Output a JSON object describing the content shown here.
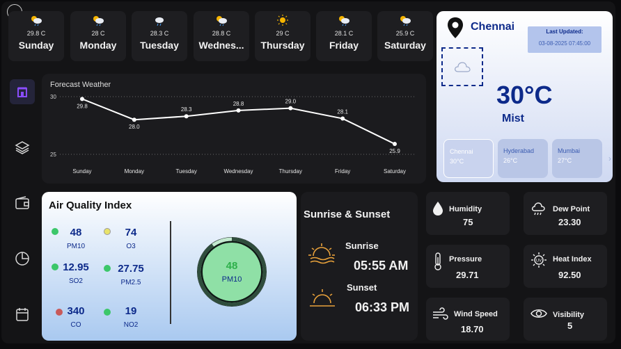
{
  "nav": {
    "back": "back"
  },
  "days": [
    {
      "temp": "29.8 C",
      "name": "Sunday",
      "icon": "partly-sunny-rain-icon"
    },
    {
      "temp": "28 C",
      "name": "Monday",
      "icon": "partly-sunny-rain-icon"
    },
    {
      "temp": "28.3 C",
      "name": "Tuesday",
      "icon": "cloud-rain-icon"
    },
    {
      "temp": "28.8 C",
      "name": "Wednes...",
      "icon": "partly-sunny-rain-icon"
    },
    {
      "temp": "29 C",
      "name": "Thursday",
      "icon": "sun-icon"
    },
    {
      "temp": "28.1 C",
      "name": "Friday",
      "icon": "partly-sunny-rain-icon"
    },
    {
      "temp": "25.9 C",
      "name": "Saturday",
      "icon": "partly-sunny-rain-icon"
    }
  ],
  "sidebar": [
    "home-icon",
    "layers-icon",
    "wallet-icon",
    "pie-chart-icon",
    "calendar-icon"
  ],
  "forecast": {
    "title": "Forecast Weather"
  },
  "chart_data": {
    "type": "line",
    "title": "Forecast Weather",
    "categories": [
      "Sunday",
      "Monday",
      "Tuesday",
      "Wednesday",
      "Thursday",
      "Friday",
      "Saturday"
    ],
    "values": [
      29.8,
      28.0,
      28.3,
      28.8,
      29.0,
      28.1,
      25.9
    ],
    "data_labels": [
      "29.8",
      "28.0",
      "28.3",
      "28.8",
      "29.0",
      "28.1",
      "25.9"
    ],
    "yticks": [
      "30",
      "25"
    ],
    "ylim": [
      25,
      30
    ],
    "grid": "dotted horizontal at 25 and 30",
    "color": "#ffffff"
  },
  "city": {
    "name": "Chennai",
    "updated_label": "Last Updated:",
    "updated_value": "03-08-2025 07:45:00",
    "temp": "30°C",
    "condition": "Mist",
    "others": [
      {
        "name": "Chennai",
        "temp": "30°C"
      },
      {
        "name": "Hyderabad",
        "temp": "26°C"
      },
      {
        "name": "Mumbai",
        "temp": "27°C"
      }
    ]
  },
  "aqi": {
    "title": "Air Quality Index",
    "items": [
      {
        "value": "48",
        "label": "PM10",
        "color": "#3cc76a"
      },
      {
        "value": "74",
        "label": "O3",
        "color": "#e8e36a"
      },
      {
        "value": "12.95",
        "label": "SO2",
        "color": "#3cc76a"
      },
      {
        "value": "27.75",
        "label": "PM2.5",
        "color": "#3cc76a"
      },
      {
        "value": "340",
        "label": "CO",
        "color": "#c85a5a"
      },
      {
        "value": "19",
        "label": "NO2",
        "color": "#3cc76a"
      }
    ],
    "gauge": {
      "value": "48",
      "label": "PM10",
      "fraction": 0.9
    }
  },
  "sun": {
    "title": "Sunrise & Sunset",
    "sunrise_label": "Sunrise",
    "sunrise_time": "05:55 AM",
    "sunset_label": "Sunset",
    "sunset_time": "06:33 PM"
  },
  "metrics": [
    {
      "label": "Humidity",
      "value": "75",
      "icon": "droplet-icon"
    },
    {
      "label": "Dew Point",
      "value": "23.30",
      "icon": "cloud-drizzle-icon"
    },
    {
      "label": "Pressure",
      "value": "29.71",
      "icon": "thermometer-icon"
    },
    {
      "label": "Heat Index",
      "value": "92.50",
      "icon": "uv-sun-icon"
    },
    {
      "label": "Wind Speed",
      "value": "18.70",
      "icon": "wind-icon"
    },
    {
      "label": "Visibility",
      "value": "5",
      "icon": "eye-icon"
    }
  ]
}
